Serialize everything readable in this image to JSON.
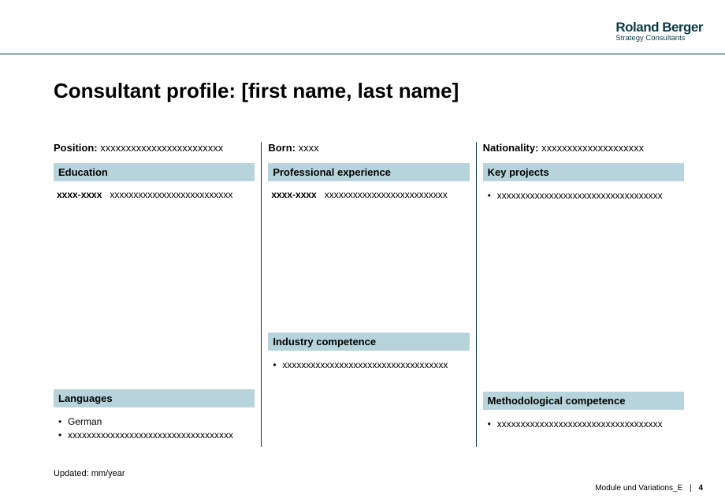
{
  "logo": {
    "main": "Roland Berger",
    "sub": "Strategy Consultants"
  },
  "title": "Consultant profile: [first name, last name]",
  "top": {
    "position_label": "Position:",
    "position_value": "xxxxxxxxxxxxxxxxxxxxxxxx",
    "born_label": "Born:",
    "born_value": "xxxx",
    "nationality_label": "Nationality:",
    "nationality_value": "xxxxxxxxxxxxxxxxxxxx"
  },
  "sections": {
    "education": {
      "heading": "Education",
      "year": "xxxx-xxxx",
      "text": "xxxxxxxxxxxxxxxxxxxxxxxxxx"
    },
    "languages": {
      "heading": "Languages",
      "items": [
        "German",
        "xxxxxxxxxxxxxxxxxxxxxxxxxxxxxxxxxxx"
      ]
    },
    "professional": {
      "heading": "Professional experience",
      "year": "xxxx-xxxx",
      "text": "xxxxxxxxxxxxxxxxxxxxxxxxxx"
    },
    "industry": {
      "heading": "Industry competence",
      "items": [
        "xxxxxxxxxxxxxxxxxxxxxxxxxxxxxxxxxxx"
      ]
    },
    "keyprojects": {
      "heading": "Key projects",
      "items": [
        "xxxxxxxxxxxxxxxxxxxxxxxxxxxxxxxxxxx"
      ]
    },
    "methodological": {
      "heading": "Methodological competence",
      "items": [
        "xxxxxxxxxxxxxxxxxxxxxxxxxxxxxxxxxxx"
      ]
    }
  },
  "updated": "Updated: mm/year",
  "footer": {
    "module": "Module und Variations_E",
    "page": "4"
  }
}
